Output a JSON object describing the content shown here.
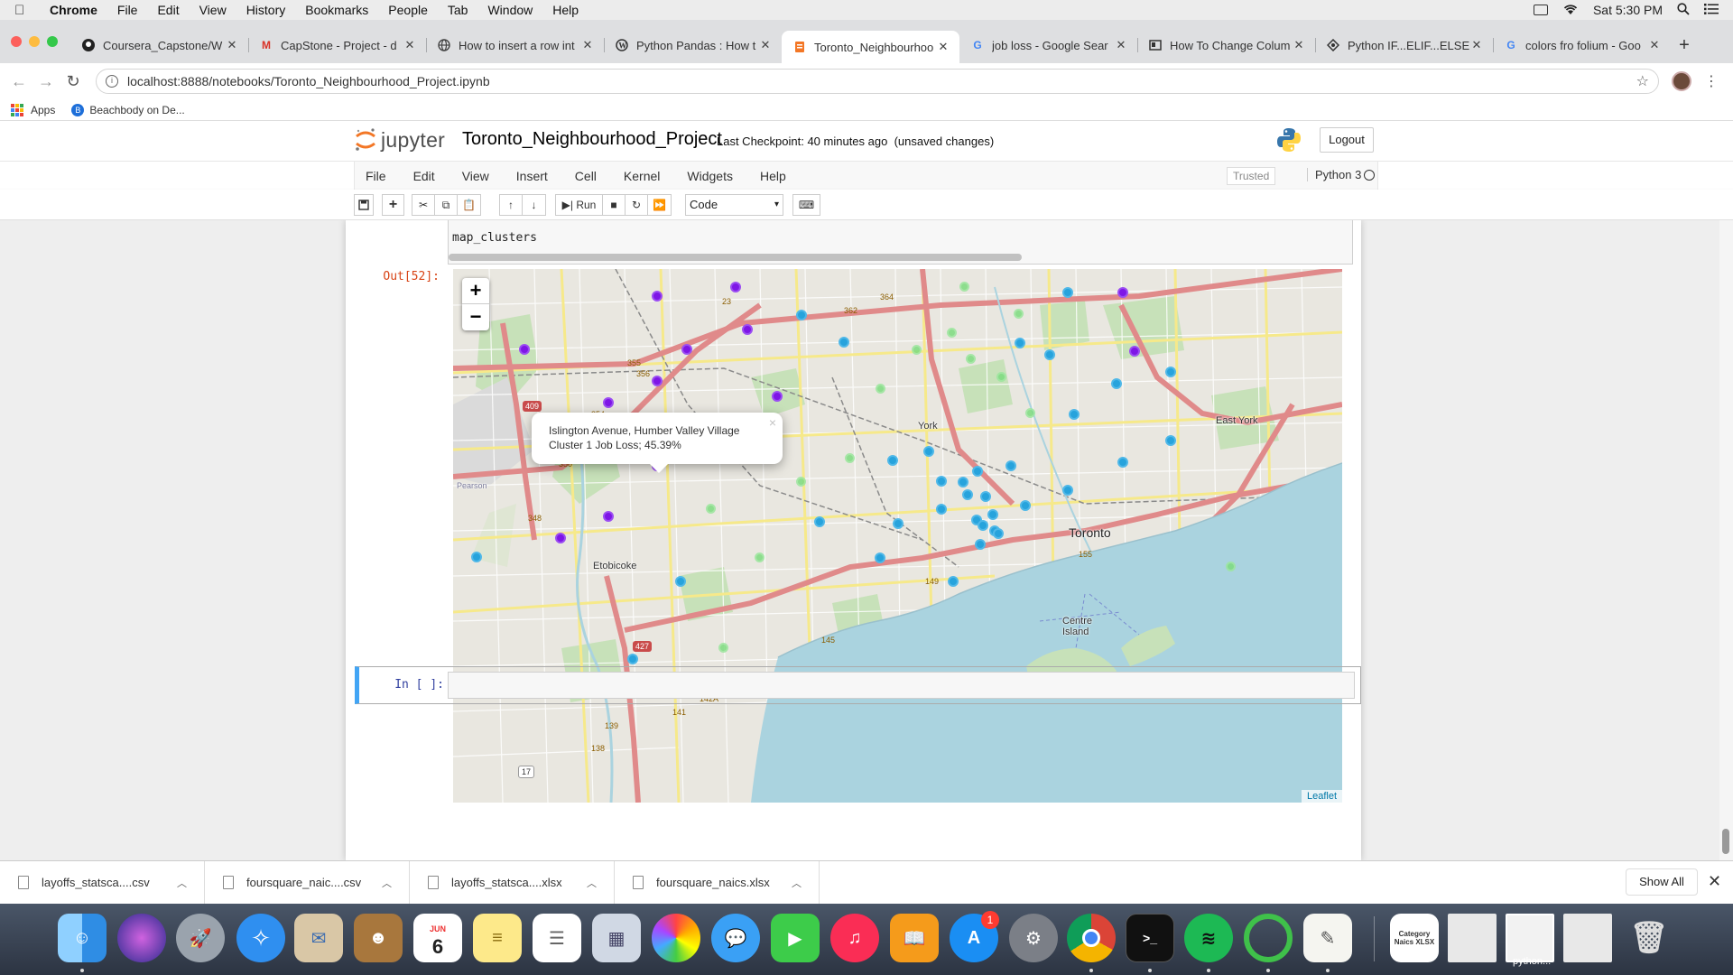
{
  "menubar": {
    "app": "Chrome",
    "items": [
      "File",
      "Edit",
      "View",
      "History",
      "Bookmarks",
      "People",
      "Tab",
      "Window",
      "Help"
    ],
    "clock": "Sat 5:30 PM"
  },
  "tabs": [
    {
      "title": "Coursera_Capstone/W",
      "icon": "github-icon",
      "active": false
    },
    {
      "title": "CapStone - Project - d",
      "icon": "gmail-icon",
      "active": false
    },
    {
      "title": "How to insert a row int",
      "icon": "globe-icon",
      "active": false
    },
    {
      "title": "Python Pandas : How t",
      "icon": "wordpress-icon",
      "active": false
    },
    {
      "title": "Toronto_Neighbourhoo",
      "icon": "jupyter-icon",
      "active": true
    },
    {
      "title": "job loss - Google Sear",
      "icon": "google-icon",
      "active": false
    },
    {
      "title": "How To Change Colum",
      "icon": "doc-icon",
      "active": false
    },
    {
      "title": "Python IF...ELIF...ELSE",
      "icon": "code-icon",
      "active": false
    },
    {
      "title": "colors fro folium - Goo",
      "icon": "google-icon",
      "active": false
    }
  ],
  "address": {
    "url": "localhost:8888/notebooks/Toronto_Neighbourhood_Project.ipynb"
  },
  "bookmarks": [
    {
      "label": "Apps",
      "icon": "apps-grid-icon"
    },
    {
      "label": "Beachbody on De...",
      "icon": "beachbody-icon"
    }
  ],
  "jupyter": {
    "logo_text": "jupyter",
    "notebook_name": "Toronto_Neighbourhood_Project",
    "checkpoint": "Last Checkpoint: 40 minutes ago",
    "unsaved": "(unsaved changes)",
    "logout": "Logout",
    "menu": [
      "File",
      "Edit",
      "View",
      "Insert",
      "Cell",
      "Kernel",
      "Widgets",
      "Help"
    ],
    "trusted": "Trusted",
    "kernel": "Python 3",
    "toolbar": {
      "run": "Run",
      "cell_type": "Code"
    }
  },
  "cell": {
    "code": "map_clusters",
    "out_prompt": "Out[52]:",
    "in_prompt": "In [ ]:"
  },
  "map": {
    "popup_text": "Islington Avenue, Humber Valley Village Cluster 1 Job Loss; 45.39%",
    "popup_close": "×",
    "attribution": "Leaflet",
    "zoom_in": "+",
    "zoom_out": "−",
    "labels": [
      "Toronto",
      "East York",
      "Etobicoke",
      "York",
      "Centre Island",
      "Toronto"
    ],
    "cluster_colors": {
      "cluster_1": "#7e16e6",
      "cluster_2": "#27a3dc",
      "cluster_3": "#7ddc7f"
    }
  },
  "downloads": [
    {
      "name": "layoffs_statsca....csv"
    },
    {
      "name": "foursquare_naic....csv"
    },
    {
      "name": "layoffs_statsca....xlsx"
    },
    {
      "name": "foursquare_naics.xlsx"
    }
  ],
  "downloads_show_all": "Show All",
  "dock": {
    "calendar_month": "JUN",
    "calendar_day": "6",
    "appstore_badge": "1",
    "file1_label": "Category Naics XLSX",
    "python_label": "python..."
  }
}
